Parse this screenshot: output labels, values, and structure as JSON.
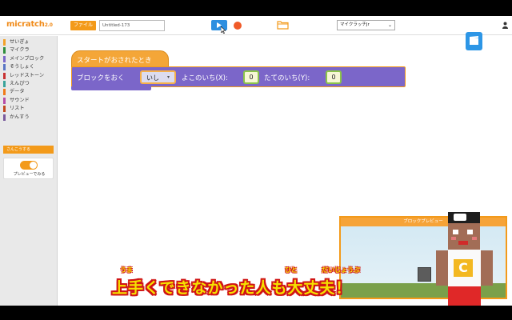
{
  "header": {
    "logo": "micratch",
    "logo_version": "2.0",
    "file_button": "ファイル",
    "project_name": "Untitled-173",
    "mode_select": "マイクラッチJr"
  },
  "palette": {
    "categories": [
      {
        "label": "せいぎょ",
        "color": "#f2a128"
      },
      {
        "label": "マイクラ",
        "color": "#2f8e3e"
      },
      {
        "label": "メインブロック",
        "color": "#7b66c9"
      },
      {
        "label": "そうしょく",
        "color": "#5a75c4"
      },
      {
        "label": "レッドストーン",
        "color": "#c83232"
      },
      {
        "label": "えんぴつ",
        "color": "#3aa39a"
      },
      {
        "label": "データ",
        "color": "#f07a1a"
      },
      {
        "label": "サウンド",
        "color": "#b54ca8"
      },
      {
        "label": "リスト",
        "color": "#c2491e"
      },
      {
        "label": "かんすう",
        "color": "#7a5b9d"
      }
    ],
    "sample_button": "さんこうする",
    "preview_label": "プレビューでみる"
  },
  "script": {
    "hat_label": "スタートがおされたとき",
    "command_label": "ブロックをおく",
    "block_dropdown": "いし",
    "x_label": "よこのいち(X):",
    "x_value": "0",
    "y_label": "たてのいち(Y):",
    "y_value": "0"
  },
  "block_preview": {
    "title": "ブロックプレビュー"
  },
  "subtitle": {
    "text": "上手くできなかった人も大丈夫！",
    "ruby_uma": "うま",
    "ruby_hito": "ひと",
    "ruby_daijoubu": "だいじょうぶ"
  },
  "colors": {
    "accent": "#f39a1a",
    "play": "#2d8fe0",
    "stop": "#f05a28",
    "command_block": "#7b66c9",
    "hat_block": "#f4a638"
  }
}
